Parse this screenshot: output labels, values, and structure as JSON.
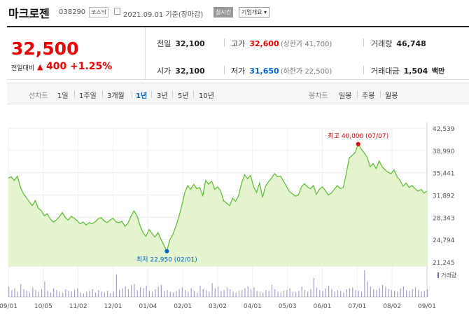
{
  "header": {
    "name": "마크로젠",
    "code": "038290",
    "market": "코스닥",
    "date": "2021.09.01 기준(장마감)",
    "realtime_label": "실시간",
    "company_label": "기업개요 ▾"
  },
  "price": {
    "current": "32,500",
    "change_label": "전일대비",
    "change_arrow": "▲",
    "change_value": "400",
    "change_percent": "+1.25%"
  },
  "stats": {
    "prev_close": {
      "label": "전일",
      "value": "32,100"
    },
    "high": {
      "label": "고가",
      "value": "32,600",
      "sub": "(상한가 41,700)"
    },
    "volume": {
      "label": "거래량",
      "value": "46,748"
    },
    "open": {
      "label": "시가",
      "value": "32,100"
    },
    "low": {
      "label": "저가",
      "value": "31,650",
      "sub": "(하한가 22,500)"
    },
    "amount": {
      "label": "거래대금",
      "value": "1,504",
      "unit": "백만"
    }
  },
  "line_tabs": {
    "label": "선차트",
    "items": [
      "1일",
      "1주일",
      "3개월",
      "1년",
      "3년",
      "5년",
      "10년"
    ],
    "active": "1년"
  },
  "candle_tabs": {
    "label": "봉차트",
    "items": [
      "일봉",
      "주봉",
      "월봉"
    ]
  },
  "colors": {
    "up": "#e00000",
    "down": "#0066cc",
    "line": "#62c03c",
    "fill": "#e3f4cf"
  },
  "chart_data": {
    "type": "area",
    "series": [
      {
        "values": [
          34600,
          34800,
          34200,
          34900,
          33200,
          32100,
          31500,
          30800,
          30200,
          31000,
          29800,
          29400,
          28600,
          28900,
          28100,
          27600,
          27900,
          28400,
          29100,
          28300,
          27900,
          28500,
          28200,
          27800,
          27300,
          27600,
          27100,
          27500,
          27300,
          27600,
          28100,
          28300,
          27800,
          27500,
          27900,
          28200,
          27600,
          27500,
          27700,
          26900,
          27400,
          28500,
          29400,
          28600,
          27100,
          25900,
          25300,
          26400,
          25800,
          25200,
          25900,
          24900,
          23900,
          22950,
          24800,
          25600,
          26900,
          28400,
          30200,
          32300,
          33400,
          32800,
          33600,
          32900,
          33100,
          31800,
          34200,
          33600,
          34100,
          32800,
          33200,
          32500,
          31000,
          30600,
          30200,
          31400,
          30900,
          31800,
          33800,
          35100,
          34500,
          35000,
          33200,
          32300,
          33800,
          31500,
          33300,
          34000,
          34600,
          35300,
          34800,
          34900,
          34100,
          33300,
          32400,
          32100,
          31700,
          31900,
          33200,
          33700,
          33200,
          32900,
          33400,
          32000,
          32800,
          33200,
          32600,
          31900,
          32200,
          32800,
          33400,
          32900,
          33100,
          35300,
          37800,
          38200,
          38700,
          40000,
          39200,
          38600,
          37900,
          36400,
          36900,
          36100,
          37300,
          36400,
          35900,
          35500,
          35300,
          35900,
          34800,
          34200,
          33300,
          33800,
          33100,
          33400,
          32900,
          32500,
          32800,
          32200,
          32500
        ]
      }
    ],
    "xlabels": [
      "09/01",
      "10/05",
      "11/02",
      "12/01",
      "01/04",
      "02/01",
      "03/02",
      "04/01",
      "05/03",
      "06/01",
      "07/01",
      "08/02",
      "09/01"
    ],
    "yticks": [
      "42,539",
      "38,990",
      "35,441",
      "31,892",
      "28,343",
      "24,794",
      "21,245"
    ],
    "ylim": [
      21245,
      42539
    ],
    "high_annotation": "최고 40,000 (07/07)",
    "low_annotation": "최저 22,950 (02/01)",
    "volume_label": "거래량",
    "volume": [
      12,
      8,
      10,
      6,
      15,
      9,
      7,
      5,
      11,
      8,
      6,
      9,
      18,
      7,
      5,
      10,
      8,
      6,
      5,
      9,
      7,
      6,
      8,
      10,
      5,
      4,
      6,
      7,
      9,
      5,
      8,
      6,
      5,
      7,
      4,
      6,
      26,
      8,
      10,
      12,
      9,
      14,
      15,
      8,
      11,
      10,
      13,
      7,
      6,
      9,
      12,
      14,
      7,
      8,
      6,
      5,
      7,
      9,
      11,
      8,
      6,
      10,
      7,
      5,
      13,
      9,
      8,
      6,
      16,
      10,
      12,
      7,
      8,
      11,
      9,
      6,
      5,
      7,
      8,
      10,
      12,
      9,
      11,
      7,
      6,
      5,
      8,
      7,
      14,
      9,
      6,
      5,
      7,
      8,
      10,
      6,
      5,
      7,
      12,
      8,
      6,
      9,
      22,
      11,
      8,
      7,
      10,
      13,
      9,
      6,
      8,
      7,
      5,
      9,
      10,
      11,
      8,
      7,
      6,
      31,
      18,
      12,
      9,
      8,
      10,
      14,
      11,
      9,
      8,
      7,
      6,
      10,
      12,
      8,
      7,
      9,
      11,
      8,
      6,
      7,
      9
    ]
  }
}
